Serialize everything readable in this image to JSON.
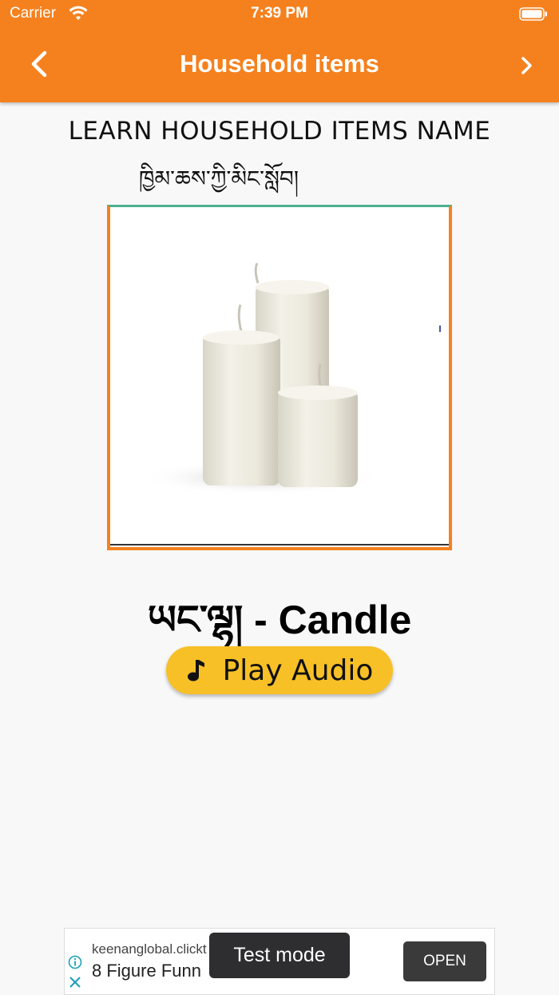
{
  "status_bar": {
    "carrier": "Carrier",
    "time": "7:39 PM"
  },
  "navbar": {
    "title": "Household items",
    "back_icon": "chevron-left-icon",
    "next_icon": "chevron-right-icon"
  },
  "content": {
    "heading": "LEARN HOUSEHOLD ITEMS NAME",
    "heading_tibetan": "ཁྱིམ་ཆས་ཀྱི་མིང་སློབ།",
    "image_subject": "candles",
    "word_label": "ཡང་ལྷ། - Candle",
    "play_button": {
      "label": "Play Audio",
      "icon": "music-note-icon"
    }
  },
  "ad": {
    "domain": "keenanglobal.clickt",
    "title": "8 Figure Funn",
    "open_label": "OPEN",
    "toast": "Test mode"
  },
  "colors": {
    "accent": "#f5811e",
    "button": "#f8c027"
  }
}
